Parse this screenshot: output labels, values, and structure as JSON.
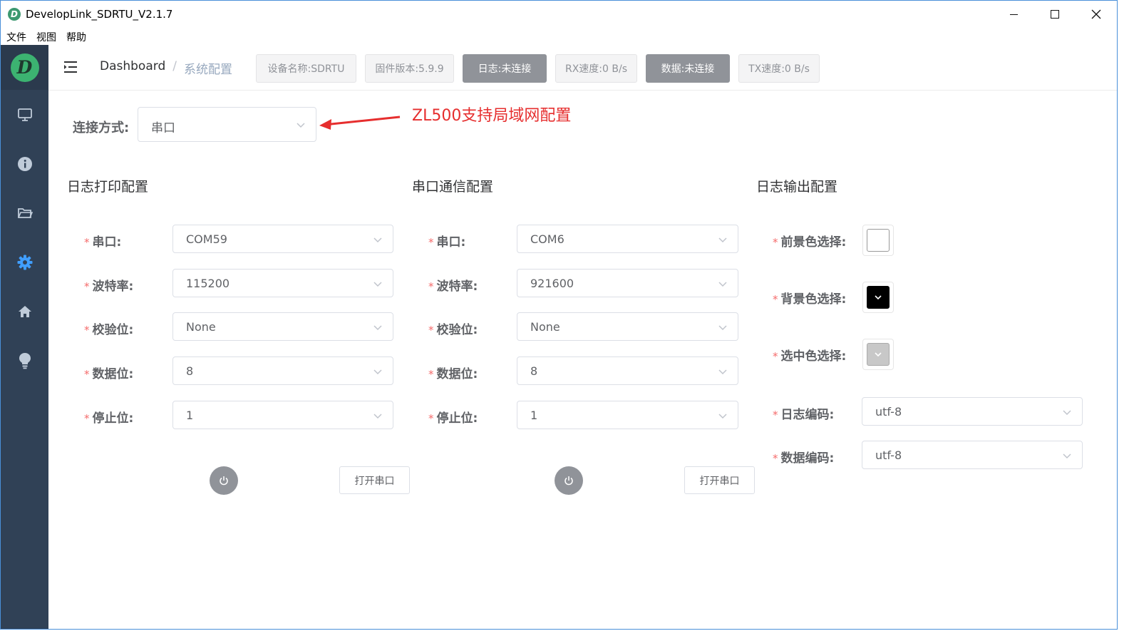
{
  "window": {
    "title": "DevelopLink_SDRTU_V2.1.7",
    "icon_letter": "D"
  },
  "menu": [
    "文件",
    "视图",
    "帮助"
  ],
  "sidebar": {
    "logo_letter": "D",
    "items": [
      {
        "icon": "monitor-icon",
        "active": false
      },
      {
        "icon": "info-icon",
        "active": false
      },
      {
        "icon": "folder-icon",
        "active": false
      },
      {
        "icon": "gear-icon",
        "active": true
      },
      {
        "icon": "home-icon",
        "active": false
      },
      {
        "icon": "lightbulb-icon",
        "active": false
      }
    ],
    "active_color": "#409eff"
  },
  "header": {
    "breadcrumb_home": "Dashboard",
    "breadcrumb_sep": "/",
    "breadcrumb_current": "系统配置",
    "status_tags": [
      {
        "text": "设备名称:SDRTU",
        "style": "light"
      },
      {
        "text": "固件版本:5.9.9",
        "style": "light"
      },
      {
        "text": "日志:未连接",
        "style": "dark"
      },
      {
        "text": "RX速度:0 B/s",
        "style": "light"
      },
      {
        "text": "数据:未连接",
        "style": "dark"
      },
      {
        "text": "TX速度:0 B/s",
        "style": "light"
      }
    ]
  },
  "connection": {
    "label": "连接方式:",
    "value": "串口"
  },
  "annotation": {
    "text": "ZL500支持局域网配置",
    "color": "#e62e2e"
  },
  "log_print": {
    "title": "日志打印配置",
    "fields": [
      {
        "label": "串口:",
        "value": "COM59"
      },
      {
        "label": "波特率:",
        "value": "115200"
      },
      {
        "label": "校验位:",
        "value": "None"
      },
      {
        "label": "数据位:",
        "value": "8"
      },
      {
        "label": "停止位:",
        "value": "1"
      }
    ],
    "open_button": "打开串口"
  },
  "serial_comm": {
    "title": "串口通信配置",
    "fields": [
      {
        "label": "串口:",
        "value": "COM6"
      },
      {
        "label": "波特率:",
        "value": "921600"
      },
      {
        "label": "校验位:",
        "value": "None"
      },
      {
        "label": "数据位:",
        "value": "8"
      },
      {
        "label": "停止位:",
        "value": "1"
      }
    ],
    "open_button": "打开串口"
  },
  "log_output": {
    "title": "日志输出配置",
    "foreground_label": "前景色选择:",
    "foreground_color": "#ffffff",
    "background_label": "背景色选择:",
    "background_color": "#000000",
    "selected_label": "选中色选择:",
    "selected_color": "#c8c8c8",
    "log_encoding_label": "日志编码:",
    "log_encoding": "utf-8",
    "data_encoding_label": "数据编码:",
    "data_encoding": "utf-8"
  },
  "required_mark": "*"
}
